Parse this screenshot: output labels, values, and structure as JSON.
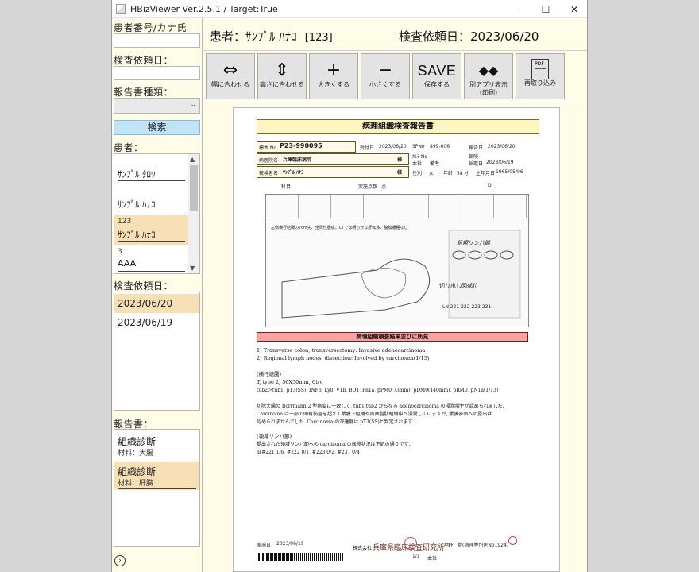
{
  "window": {
    "title": "HBizViewer Ver.2.5.1 / Target:True",
    "min_icon": "minimize-icon",
    "max_icon": "maximize-icon",
    "close_icon": "close-icon"
  },
  "left": {
    "patient_search_label": "患者番号/カナ氏名：",
    "patient_search_value": "",
    "request_date_label": "検査依頼日：",
    "request_date_value": "",
    "report_type_label": "報告書種類：",
    "report_type_value": "",
    "search_button": "検索",
    "patients_label": "患者：",
    "patients": [
      {
        "id": "",
        "name": "ｻﾝﾌﾟﾙ ﾀﾛｳ",
        "selected": false
      },
      {
        "id": "",
        "name": "ｻﾝﾌﾟﾙ ﾊﾅｺ",
        "selected": false
      },
      {
        "id": "123",
        "name": "ｻﾝﾌﾟﾙ ﾊﾅｺ",
        "selected": true
      },
      {
        "id": "3",
        "name": "AAA",
        "selected": false
      }
    ],
    "dates_label": "検査依頼日：",
    "dates": [
      {
        "label": "2023/06/20",
        "selected": true
      },
      {
        "label": "2023/06/19",
        "selected": false
      }
    ],
    "reports_label": "報告書：",
    "reports": [
      {
        "title": "組織診断",
        "material": "材料：大腸",
        "selected": false
      },
      {
        "title": "組織診断",
        "material": "材料：肝臓",
        "selected": true
      }
    ],
    "nav_icon": "chevron-right-circle-icon"
  },
  "header": {
    "patient_prefix": "患者：",
    "patient_name": "ｻﾝﾌﾟﾙ ﾊﾅｺ",
    "patient_number": "[123]",
    "request_date_text": "検査依頼日：2023/06/20"
  },
  "toolbar": {
    "fit_width": {
      "glyph": "⇔",
      "label": "幅に合わせる"
    },
    "fit_height": {
      "glyph": "⇕",
      "label": "高さに合わせる"
    },
    "zoom_in": {
      "glyph": "+",
      "label": "大きくする"
    },
    "zoom_out": {
      "glyph": "−",
      "label": "小さくする"
    },
    "save": {
      "glyph": "SAVE",
      "label": "保存する"
    },
    "external": {
      "glyph": "◆◆",
      "label": "別アプリ表示",
      "label2": "(印刷)"
    },
    "reload": {
      "glyph": "-PDF-",
      "label": "再取り込み"
    }
  },
  "document": {
    "title": "病理組織検査報告書",
    "specimen_no_label": "標本 No.",
    "specimen_no": "P23-990095",
    "received_label": "受付日",
    "received_date": "2023/06/20",
    "spno_label": "SPNo",
    "spno": "899-006",
    "report_date_label": "報告日",
    "report_date": "2023/06/20",
    "hospital_label": "病医院名",
    "hospital": "兵庫臨床病院",
    "sama": "様",
    "dept_label": "ｶﾙﾃ No",
    "insurance_label": "保険",
    "honsha": "本社",
    "memo_label": "備考",
    "collect_label": "採取日",
    "collect_date": "2023/06/19",
    "patient_label": "被検者名",
    "patient": "ｻﾝﾌﾟﾙ ﾊﾅｺ",
    "sex_label": "性別",
    "sex": "女",
    "age_label": "年齢",
    "age": "58 才",
    "dob_label": "生年月日",
    "dob": "1965/05/06",
    "subject_label": "科目",
    "count_label": "実施点数",
    "count": "点",
    "dr_label": "Dr",
    "specimen_type": "切り出し図部位",
    "sketch_note": "左側横行結腸の7cm先、全周性腫瘍。CTでは明らかな肝転移、腹膜播種なし",
    "lymph_hand": "新規リンパ節",
    "lymph_codes": "LN  221  222  223  231",
    "findings_header": "病理組織検査結果並びに所見",
    "line1": "1) Transverse colon, transversectomy: Invasive adenocarcinoma",
    "line2": "2) Regional lymph nodes, dissection: Involved by carcinoma(1/13)",
    "line3": "(横行結腸)",
    "line4": "T, type 2, 56X50mm, Circ",
    "line5": "tub2＞tub1, pT3(SS), INFb, Ly0, V1b, BD1, Pn1a, pPM0(73mm), pDM0(140mm), pRM0, pN1a(1/13)",
    "line6": "切除大腸の Borrmann 2 型病変に一致して, tub1,tub2 からなる adenocarcinoma の浸潤増生が認められました.",
    "line7": "Carcinoma は一部で固有筋層を超えて漿膜下組織や周囲脂肪組織中へ浸潤していますが, 漿膜表面への露出は",
    "line8": "認められませんでした. Carcinoma の深達度は pT3(SS)と判定されます.",
    "line9": "(領域リンパ節)",
    "line10": "提出された領域リンパ節への carcinoma の転移状況は下記の通りです.",
    "line11": "n[#221 1/6, #222 0/1, #223 0/2, #231 0/4]",
    "footer_date_label": "実施日",
    "footer_date": "2023/06/19",
    "company": "株式会社",
    "lab_name": "兵庫県臨床検査研究所",
    "doctor": "沖野　毅(病理専門医No1924)",
    "page": "1/1",
    "office": "本社"
  }
}
